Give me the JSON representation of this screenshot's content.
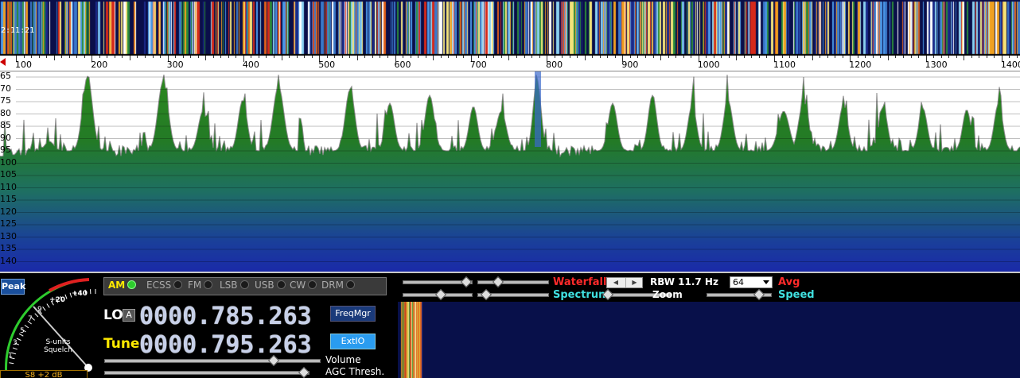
{
  "waterfall": {
    "time_label": "2:11:21"
  },
  "frequency_scale": {
    "labels": [
      "100",
      "200",
      "300",
      "400",
      "500",
      "600",
      "700",
      "800",
      "900",
      "1000",
      "1100",
      "1200",
      "1300",
      "1400"
    ]
  },
  "spectrum": {
    "db_labels": [
      "65",
      "70",
      "75",
      "80",
      "85",
      "90",
      "95",
      "100",
      "105",
      "110",
      "115",
      "120",
      "125",
      "130",
      "135",
      "140"
    ]
  },
  "smeter": {
    "peak_label": "Peak",
    "scale_labels": [
      "+40",
      "+20",
      "9",
      "7",
      "5",
      "3",
      "1"
    ],
    "label_line1": "S-units",
    "label_line2": "Squelch",
    "readout": "S8 +2 dB"
  },
  "modes": [
    {
      "label": "AM",
      "active": true
    },
    {
      "label": "ECSS",
      "active": false
    },
    {
      "label": "FM",
      "active": false
    },
    {
      "label": "LSB",
      "active": false
    },
    {
      "label": "USB",
      "active": false
    },
    {
      "label": "CW",
      "active": false
    },
    {
      "label": "DRM",
      "active": false
    }
  ],
  "lo": {
    "label": "LO",
    "a_button": "A",
    "value": "0000.785.263"
  },
  "tune": {
    "label": "Tune",
    "value": "0000.795.263"
  },
  "buttons": {
    "freqmgr": "FreqMgr",
    "extio": "ExtIO"
  },
  "sliders": {
    "volume_label": "Volume",
    "agc_label": "AGC Thresh.",
    "volume_level": 0.78,
    "agc_level": 0.97
  },
  "display_controls": {
    "waterfall_label": "Waterfall",
    "spectrum_label": "Spectrum",
    "rbw_label": "RBW 11.7 Hz",
    "zoom_label": "Zoom",
    "avg_value": "64",
    "avg_label": "Avg",
    "speed_label": "Speed"
  },
  "colors": {
    "accent_red": "#ff2a2a",
    "accent_cyan": "#40e0e0",
    "digits": "#c7d0e8",
    "active_mode": "#ffea00"
  }
}
